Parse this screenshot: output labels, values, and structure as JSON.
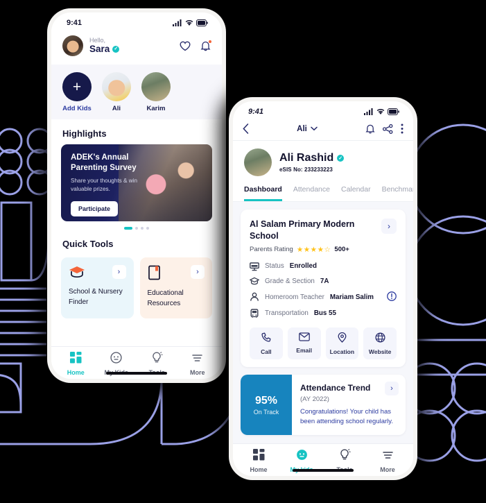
{
  "colors": {
    "background": "#000000",
    "accent_teal": "#17c3c3",
    "navy": "#16194a",
    "indigo": "#2c3ba0",
    "blue_panel": "#1784be",
    "orange": "#f4653a",
    "star_gold": "#ffc21a",
    "deco_line": "#9aa0e6"
  },
  "phone1": {
    "status_bar": {
      "time": "9:41",
      "cellular_icon": "signal-bars-icon",
      "wifi_icon": "wifi-icon",
      "battery_icon": "battery-icon"
    },
    "header": {
      "avatar_icon": "user-avatar",
      "greeting": "Hello,",
      "user_name": "Sara",
      "verified_icon": "verified-badge-icon",
      "heart_icon": "heart-icon",
      "bell_icon": "bell-notification-icon"
    },
    "kids": [
      {
        "label": "Add Kids",
        "icon": "plus-icon",
        "type": "add"
      },
      {
        "label": "Ali",
        "icon": "child-avatar",
        "type": "child"
      },
      {
        "label": "Karim",
        "icon": "child-avatar",
        "type": "child"
      }
    ],
    "highlights": {
      "section_title": "Highlights",
      "card": {
        "title": "ADEK's Annual Parenting Survey",
        "subtitle": "Share your thoughts & win valuable prizes.",
        "button_label": "Participate"
      },
      "carousel": {
        "total_dots": 4,
        "active_index": 0
      }
    },
    "quick_tools": {
      "section_title": "Quick Tools",
      "cards": [
        {
          "label": "School & Nursery Finder",
          "icon": "graduation-cap-icon",
          "chevron": "chevron-right-icon"
        },
        {
          "label": "Educational Resources",
          "icon": "book-icon",
          "chevron": "chevron-right-icon"
        }
      ]
    },
    "bottom_nav": {
      "items": [
        {
          "label": "Home",
          "icon": "grid-icon",
          "active": true
        },
        {
          "label": "My Kids",
          "icon": "child-face-icon",
          "active": false
        },
        {
          "label": "Tools",
          "icon": "bulb-icon",
          "active": false
        },
        {
          "label": "More",
          "icon": "menu-lines-icon",
          "active": false
        }
      ]
    }
  },
  "phone2": {
    "status_bar": {
      "time": "9:41",
      "cellular_icon": "signal-bars-icon",
      "wifi_icon": "wifi-icon",
      "battery_icon": "battery-icon"
    },
    "topbar": {
      "back_icon": "chevron-left-icon",
      "title": "Ali",
      "dropdown_icon": "chevron-down-icon",
      "bell_icon": "bell-icon",
      "share_icon": "share-icon",
      "more_icon": "kebab-menu-icon"
    },
    "profile": {
      "avatar_icon": "child-avatar",
      "name": "Ali Rashid",
      "verified_icon": "verified-badge-icon",
      "sis_label": "eSIS No: 233233223"
    },
    "tabs": [
      {
        "label": "Dashboard",
        "active": true
      },
      {
        "label": "Attendance",
        "active": false
      },
      {
        "label": "Calendar",
        "active": false
      },
      {
        "label": "Benchmark R",
        "active": false
      }
    ],
    "school_card": {
      "name": "Al Salam Primary Modern School",
      "rating_label": "Parents Rating",
      "stars_filled": 4,
      "stars_total": 5,
      "rating_count": "500+",
      "chevron": "chevron-right-icon",
      "info": [
        {
          "icon": "school-building-icon",
          "label": "Status",
          "value": "Enrolled",
          "warn": false
        },
        {
          "icon": "graduation-cap-icon",
          "label": "Grade & Section",
          "value": "7A",
          "warn": false
        },
        {
          "icon": "person-icon",
          "label": "Homeroom Teacher",
          "value": "Mariam Salim",
          "warn": true,
          "warn_icon": "alert-circle-icon"
        },
        {
          "icon": "bus-icon",
          "label": "Transportation",
          "value": "Bus 55",
          "warn": false
        }
      ],
      "contacts": [
        {
          "label": "Call",
          "icon": "phone-icon"
        },
        {
          "label": "Email",
          "icon": "envelope-icon"
        },
        {
          "label": "Location",
          "icon": "map-pin-icon"
        },
        {
          "label": "Website",
          "icon": "globe-icon"
        }
      ]
    },
    "attendance_card": {
      "percent": "95%",
      "status": "On Track",
      "title": "Attendance Trend",
      "year": "(AY 2022)",
      "message": "Congratulations! Your child has been attending school regularly.",
      "chevron": "chevron-right-icon"
    },
    "bottom_nav": {
      "items": [
        {
          "label": "Home",
          "icon": "grid-icon",
          "active": false
        },
        {
          "label": "My kids",
          "icon": "child-face-icon",
          "active": true
        },
        {
          "label": "Tools",
          "icon": "bulb-icon",
          "active": false
        },
        {
          "label": "More",
          "icon": "menu-lines-icon",
          "active": false
        }
      ]
    }
  }
}
